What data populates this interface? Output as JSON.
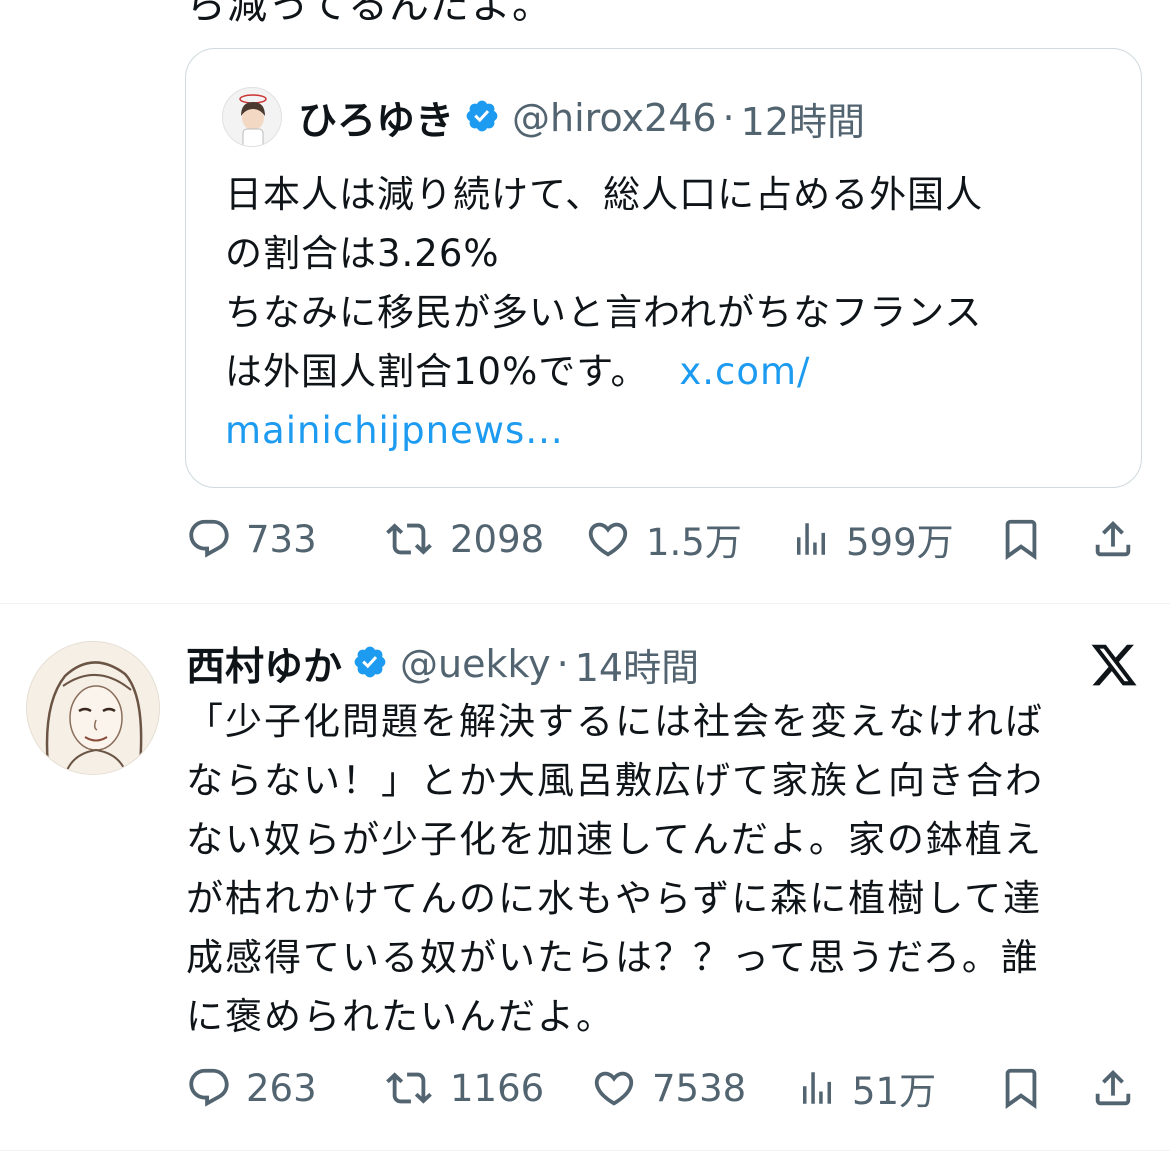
{
  "previous_post": {
    "clipped_text": "ら減ってるんだよ。"
  },
  "quoted_post": {
    "author_name": "ひろゆき",
    "handle": "@hirox246",
    "separator": "·",
    "time": "12時間",
    "body_lines": [
      "日本人は減り続けて、総人口に占める外国人",
      "の割合は3.26%",
      "ちなみに移民が多いと言われがちなフランス",
      "は外国人割合10%です。"
    ],
    "link_part1": "x.com/",
    "link_part2": "mainichijpnews..."
  },
  "post1_actions": {
    "replies": "733",
    "reposts": "2098",
    "likes": "1.5万",
    "views": "599万"
  },
  "post2": {
    "author_name": "西村ゆか",
    "handle": "@uekky",
    "separator": "·",
    "time": "14時間",
    "body_lines": [
      "「少子化問題を解決するには社会を変えなければ",
      "ならない！」とか大風呂敷広げて家族と向き合わ",
      "ない奴らが少子化を加速してんだよ。家の鉢植え",
      "が枯れかけてんのに水もやらずに森に植樹して達",
      "成感得ている奴がいたらは？？って思うだろ。誰",
      "に褒められたいんだよ。"
    ]
  },
  "post2_actions": {
    "replies": "263",
    "reposts": "1166",
    "likes": "7538",
    "views": "51万"
  },
  "icons": {
    "verified": "verified-badge-icon",
    "reply": "reply-icon",
    "repost": "repost-icon",
    "like": "heart-icon",
    "views": "views-icon",
    "bookmark": "bookmark-icon",
    "share": "share-icon",
    "logo": "x-logo-icon"
  },
  "colors": {
    "text": "#0f1419",
    "secondary": "#536471",
    "link": "#1d9bf0",
    "verified": "#1d9bf0",
    "border": "#cfd9de"
  }
}
